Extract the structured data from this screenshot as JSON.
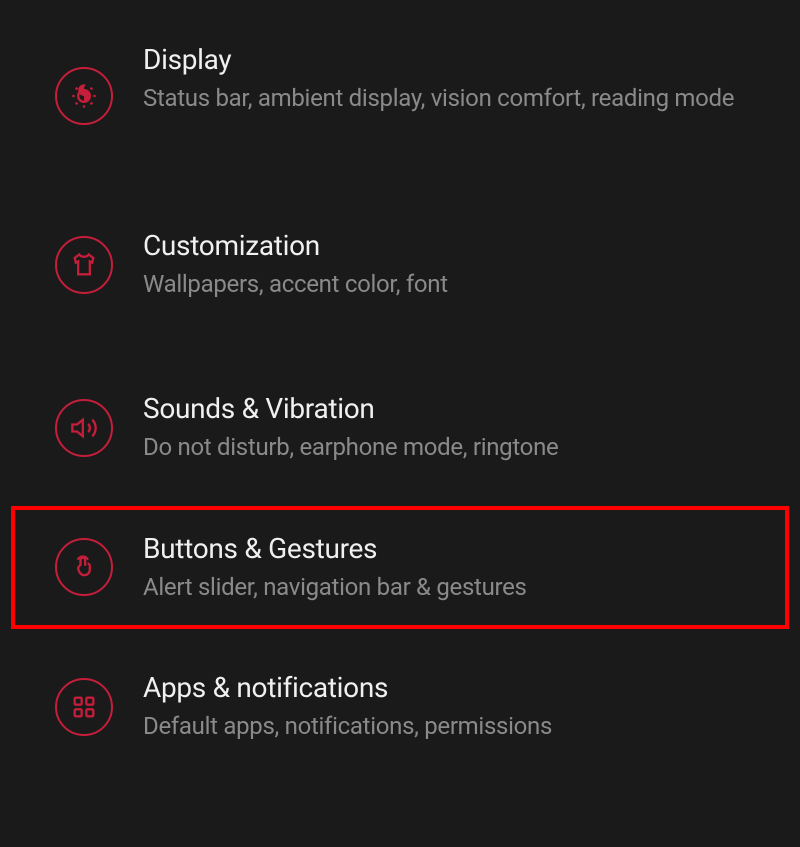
{
  "settings": {
    "items": [
      {
        "title": "Display",
        "subtitle": "Status bar, ambient display, vision comfort, reading mode",
        "icon": "brightness"
      },
      {
        "title": "Customization",
        "subtitle": "Wallpapers, accent color, font",
        "icon": "shirt"
      },
      {
        "title": "Sounds & Vibration",
        "subtitle": "Do not disturb, earphone mode, ringtone",
        "icon": "volume"
      },
      {
        "title": "Buttons & Gestures",
        "subtitle": "Alert slider, navigation bar & gestures",
        "icon": "touch"
      },
      {
        "title": "Apps & notifications",
        "subtitle": "Default apps, notifications, permissions",
        "icon": "apps"
      }
    ]
  }
}
